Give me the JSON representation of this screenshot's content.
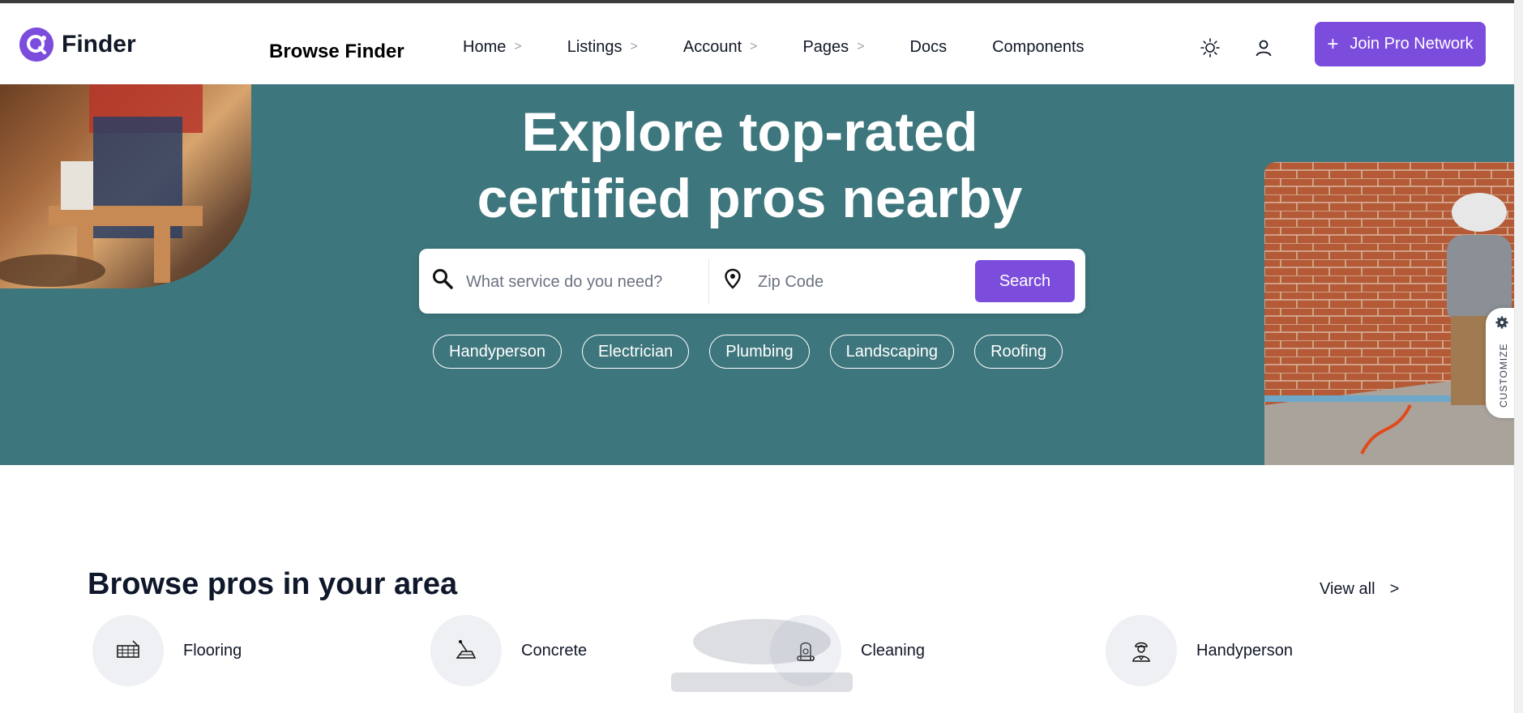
{
  "header": {
    "logo_text": "Finder",
    "page_title": "Browse Finder",
    "nav": [
      {
        "label": "Home",
        "has_chevron": true
      },
      {
        "label": "Listings",
        "has_chevron": true
      },
      {
        "label": "Account",
        "has_chevron": true
      },
      {
        "label": "Pages",
        "has_chevron": true
      },
      {
        "label": "Docs",
        "has_chevron": false
      },
      {
        "label": "Components",
        "has_chevron": false
      }
    ],
    "chevron": ">",
    "join_button": {
      "icon": "+",
      "label": "Join Pro Network"
    }
  },
  "hero": {
    "title_line1": "Explore top-rated",
    "title_line2": "certified pros nearby",
    "search": {
      "service_placeholder": "What service do you need?",
      "zip_placeholder": "Zip Code",
      "button_label": "Search"
    },
    "chips": [
      "Handyperson",
      "Electrician",
      "Plumbing",
      "Landscaping",
      "Roofing"
    ],
    "customize_label": "CUSTOMIZE"
  },
  "section": {
    "title": "Browse pros in your area",
    "view_all": "View all",
    "view_all_arrow": ">",
    "categories": [
      {
        "label": "Flooring",
        "icon": "flooring-icon"
      },
      {
        "label": "Concrete",
        "icon": "concrete-icon"
      },
      {
        "label": "Cleaning",
        "icon": "vacuum-icon"
      },
      {
        "label": "Handyperson",
        "icon": "worker-icon"
      }
    ]
  },
  "colors": {
    "accent": "#7c4ddc",
    "hero_bg": "#3d767c",
    "text": "#111827"
  }
}
